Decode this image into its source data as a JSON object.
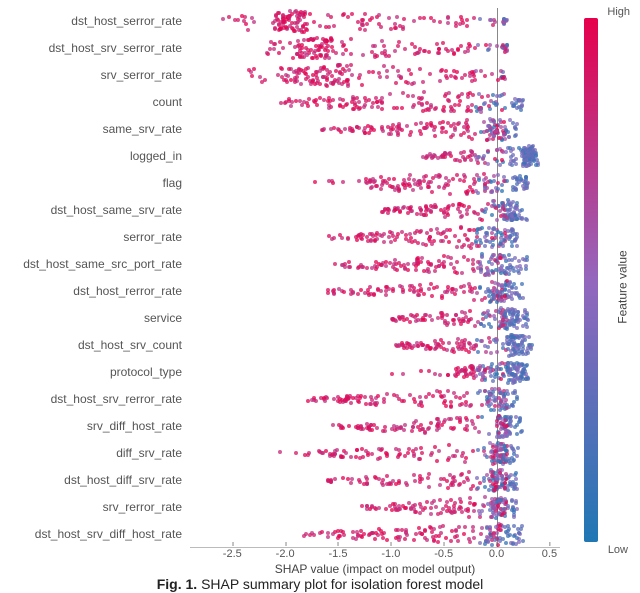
{
  "chart_data": {
    "type": "beeswarm",
    "title": "",
    "xlabel": "SHAP value (impact on model output)",
    "ylabel": "",
    "xlim": [
      -2.9,
      0.6
    ],
    "x_ticks": [
      -2.5,
      -2.0,
      -1.5,
      -1.0,
      -0.5,
      0.0,
      0.5
    ],
    "colorbar": {
      "low": "Low",
      "high": "High",
      "label": "Feature value"
    },
    "features": [
      {
        "name": "dst_host_serror_rate",
        "shap_min": -2.6,
        "shap_max": 0.1,
        "bulk_left": -2.1,
        "bulk_right": 0.06,
        "peak": -1.8
      },
      {
        "name": "dst_host_srv_serror_rate",
        "shap_min": -2.2,
        "shap_max": 0.1,
        "bulk_left": -1.9,
        "bulk_right": 0.05,
        "peak": -1.55
      },
      {
        "name": "srv_serror_rate",
        "shap_min": -2.35,
        "shap_max": 0.08,
        "bulk_left": -2.0,
        "bulk_right": 0.05,
        "peak": -1.4
      },
      {
        "name": "count",
        "shap_min": -2.05,
        "shap_max": 0.25,
        "bulk_left": -1.8,
        "bulk_right": 0.2,
        "peak": -0.5
      },
      {
        "name": "same_srv_rate",
        "shap_min": -1.65,
        "shap_max": 0.2,
        "bulk_left": -1.4,
        "bulk_right": 0.1,
        "peak": -0.1
      },
      {
        "name": "logged_in",
        "shap_min": -0.7,
        "shap_max": 0.4,
        "bulk_left": -0.55,
        "bulk_right": 0.35,
        "peak": 0.25
      },
      {
        "name": "flag",
        "shap_min": -1.8,
        "shap_max": 0.3,
        "bulk_left": -1.2,
        "bulk_right": 0.25,
        "peak": -0.35
      },
      {
        "name": "dst_host_same_srv_rate",
        "shap_min": -1.1,
        "shap_max": 0.3,
        "bulk_left": -0.9,
        "bulk_right": 0.2,
        "peak": 0.05
      },
      {
        "name": "serror_rate",
        "shap_min": -1.6,
        "shap_max": 0.2,
        "bulk_left": -1.3,
        "bulk_right": 0.1,
        "peak": -0.2
      },
      {
        "name": "dst_host_same_src_port_rate",
        "shap_min": -1.55,
        "shap_max": 0.3,
        "bulk_left": -1.3,
        "bulk_right": 0.2,
        "peak": -0.1
      },
      {
        "name": "dst_host_rerror_rate",
        "shap_min": -1.6,
        "shap_max": 0.25,
        "bulk_left": -1.35,
        "bulk_right": 0.15,
        "peak": -0.05
      },
      {
        "name": "service",
        "shap_min": -1.0,
        "shap_max": 0.3,
        "bulk_left": -0.85,
        "bulk_right": 0.2,
        "peak": 0.05
      },
      {
        "name": "dst_host_srv_count",
        "shap_min": -0.95,
        "shap_max": 0.35,
        "bulk_left": -0.8,
        "bulk_right": 0.25,
        "peak": 0.1
      },
      {
        "name": "protocol_type",
        "shap_min": -1.1,
        "shap_max": 0.3,
        "bulk_left": -0.4,
        "bulk_right": 0.25,
        "peak": 0.1
      },
      {
        "name": "dst_host_srv_rerror_rate",
        "shap_min": -1.8,
        "shap_max": 0.2,
        "bulk_left": -1.5,
        "bulk_right": 0.1,
        "peak": -0.1
      },
      {
        "name": "srv_diff_host_rate",
        "shap_min": -1.55,
        "shap_max": 0.25,
        "bulk_left": -1.3,
        "bulk_right": 0.15,
        "peak": 0.0
      },
      {
        "name": "diff_srv_rate",
        "shap_min": -2.05,
        "shap_max": 0.2,
        "bulk_left": -1.7,
        "bulk_right": 0.1,
        "peak": -0.05
      },
      {
        "name": "dst_host_diff_srv_rate",
        "shap_min": -1.6,
        "shap_max": 0.2,
        "bulk_left": -1.35,
        "bulk_right": 0.12,
        "peak": -0.05
      },
      {
        "name": "srv_rerror_rate",
        "shap_min": -1.3,
        "shap_max": 0.2,
        "bulk_left": -1.1,
        "bulk_right": 0.1,
        "peak": -0.05
      },
      {
        "name": "dst_host_srv_diff_host_rate",
        "shap_min": -1.85,
        "shap_max": 0.25,
        "bulk_left": -1.55,
        "bulk_right": 0.15,
        "peak": -0.1
      }
    ]
  },
  "caption_prefix": "Fig. 1.",
  "caption_text": " SHAP summary plot for isolation forest model"
}
